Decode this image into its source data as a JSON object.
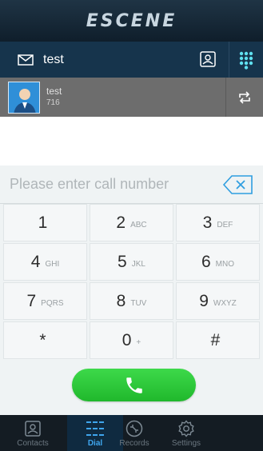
{
  "header": {
    "logo": "ESCENE",
    "account_name": "test"
  },
  "line": {
    "name": "test",
    "number": "716"
  },
  "dialer": {
    "placeholder": "Please enter call number",
    "keys": [
      {
        "digit": "1",
        "letters": ""
      },
      {
        "digit": "2",
        "letters": "ABC"
      },
      {
        "digit": "3",
        "letters": "DEF"
      },
      {
        "digit": "4",
        "letters": "GHI"
      },
      {
        "digit": "5",
        "letters": "JKL"
      },
      {
        "digit": "6",
        "letters": "MNO"
      },
      {
        "digit": "7",
        "letters": "PQRS"
      },
      {
        "digit": "8",
        "letters": "TUV"
      },
      {
        "digit": "9",
        "letters": "WXYZ"
      },
      {
        "digit": "*",
        "letters": ""
      },
      {
        "digit": "0",
        "letters": "+"
      },
      {
        "digit": "#",
        "letters": ""
      }
    ]
  },
  "nav": {
    "items": [
      {
        "label": "Contacts",
        "icon": "contacts-icon",
        "active": false
      },
      {
        "label": "Dial",
        "icon": "dialpad-icon",
        "active": true
      },
      {
        "label": "Records",
        "icon": "records-icon",
        "active": false
      },
      {
        "label": "Settings",
        "icon": "settings-icon",
        "active": false
      }
    ]
  },
  "colors": {
    "header_bg": "#16344c",
    "accent": "#3fa6ee",
    "call_green": "#2ec93a"
  }
}
